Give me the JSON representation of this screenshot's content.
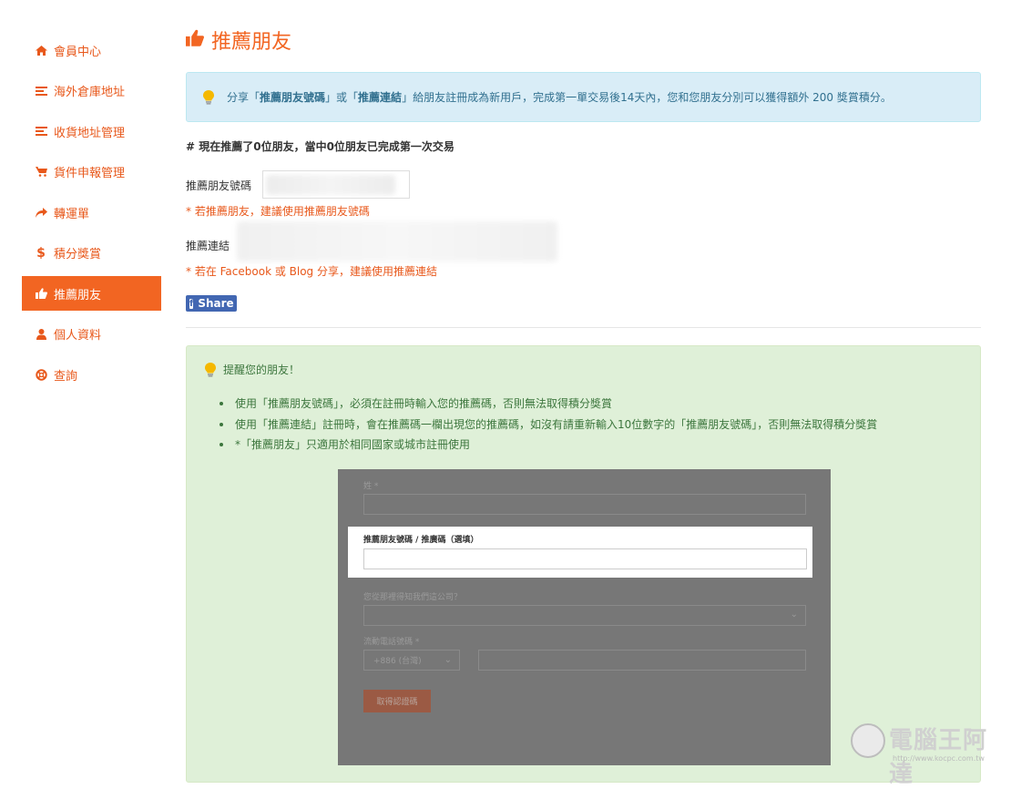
{
  "sidebar": {
    "items": [
      {
        "label": "會員中心",
        "icon": "home-icon"
      },
      {
        "label": "海外倉庫地址",
        "icon": "list-icon"
      },
      {
        "label": "收貨地址管理",
        "icon": "list-icon"
      },
      {
        "label": "貨件申報管理",
        "icon": "cart-icon"
      },
      {
        "label": "轉運單",
        "icon": "share-arrow-icon"
      },
      {
        "label": "積分獎賞",
        "icon": "dollar-icon"
      },
      {
        "label": "推薦朋友",
        "icon": "thumbs-up-icon",
        "active": true
      },
      {
        "label": "個人資料",
        "icon": "user-icon"
      },
      {
        "label": "查詢",
        "icon": "life-ring-icon"
      }
    ]
  },
  "page": {
    "title": "推薦朋友",
    "info": {
      "pre": "分享「",
      "code_term": "推薦朋友號碼",
      "mid1": "」或「",
      "link_term": "推薦連結",
      "post": "」給朋友註冊成為新用戶，完成第一單交易後14天內，您和您朋友分別可以獲得額外 200 獎賞積分。"
    },
    "count_line": "# 現在推薦了0位朋友，當中0位朋友已完成第一次交易",
    "code_label": "推薦朋友號碼",
    "code_hint": "* 若推薦朋友，建議使用推薦朋友號碼",
    "link_label": "推薦連結",
    "link_hint": "* 若在 Facebook 或 Blog 分享，建議使用推薦連結",
    "share_label": "Share",
    "share_icon_glyph": "f"
  },
  "reminder": {
    "title": "提醒您的朋友！",
    "items": [
      "使用「推薦朋友號碼」，必須在註冊時輸入您的推薦碼，否則無法取得積分獎賞",
      "使用「推薦連結」註冊時，會在推薦碼一欄出現您的推薦碼，如沒有請重新輸入10位數字的「推薦朋友號碼」，否則無法取得積分獎賞",
      "*「推薦朋友」只適用於相同國家或城市註冊使用"
    ]
  },
  "demo_form": {
    "surname_label": "姓 *",
    "referral_label": "推薦朋友號碼 / 推廣碼（選填）",
    "source_label": "您從那裡得知我們這公司？",
    "mobile_label": "流動電話號碼 *",
    "country_code": "+886 (台灣)",
    "otp_button": "取得認證碼",
    "chevron_glyph": "⌄"
  },
  "watermark": {
    "name": "電腦王阿達",
    "url": "http://www.kocpc.com.tw"
  },
  "colors": {
    "accent": "#f26522",
    "info_bg": "#d9edf7",
    "success_bg": "#dff0d8",
    "facebook": "#4267b2"
  }
}
